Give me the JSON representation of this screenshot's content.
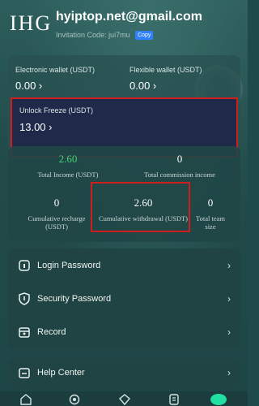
{
  "header": {
    "logo": "IHG",
    "email": "hyiptop.net@gmail.com",
    "invitation_label": "Invitation Code:",
    "invitation_code": "jui7mu",
    "copy_label": "Copy"
  },
  "wallet": {
    "electronic_label": "Electronic wallet (USDT)",
    "electronic_value": "0.00",
    "flexible_label": "Flexible wallet (USDT)",
    "flexible_value": "0.00",
    "unlock_label": "Unlock Freeze (USDT)",
    "unlock_value": "13.00"
  },
  "stats": {
    "total_income_value": "2.60",
    "total_income_label": "Total Income (USDT)",
    "total_commission_value": "0",
    "total_commission_label": "Total commission income",
    "cumulative_recharge_value": "0",
    "cumulative_recharge_label": "Cumulative recharge (USDT)",
    "cumulative_withdrawal_value": "2.60",
    "cumulative_withdrawal_label": "Cumulative withdrawal (USDT)",
    "team_size_value": "0",
    "team_size_label": "Total team size"
  },
  "menu": {
    "login_password": "Login Password",
    "security_password": "Security Password",
    "record": "Record",
    "help_center": "Help Center"
  },
  "colors": {
    "accent_green": "#42d675",
    "copy_blue": "#2f80ff",
    "highlight_red": "#d01e1e",
    "nav_active": "#21e0a1"
  }
}
